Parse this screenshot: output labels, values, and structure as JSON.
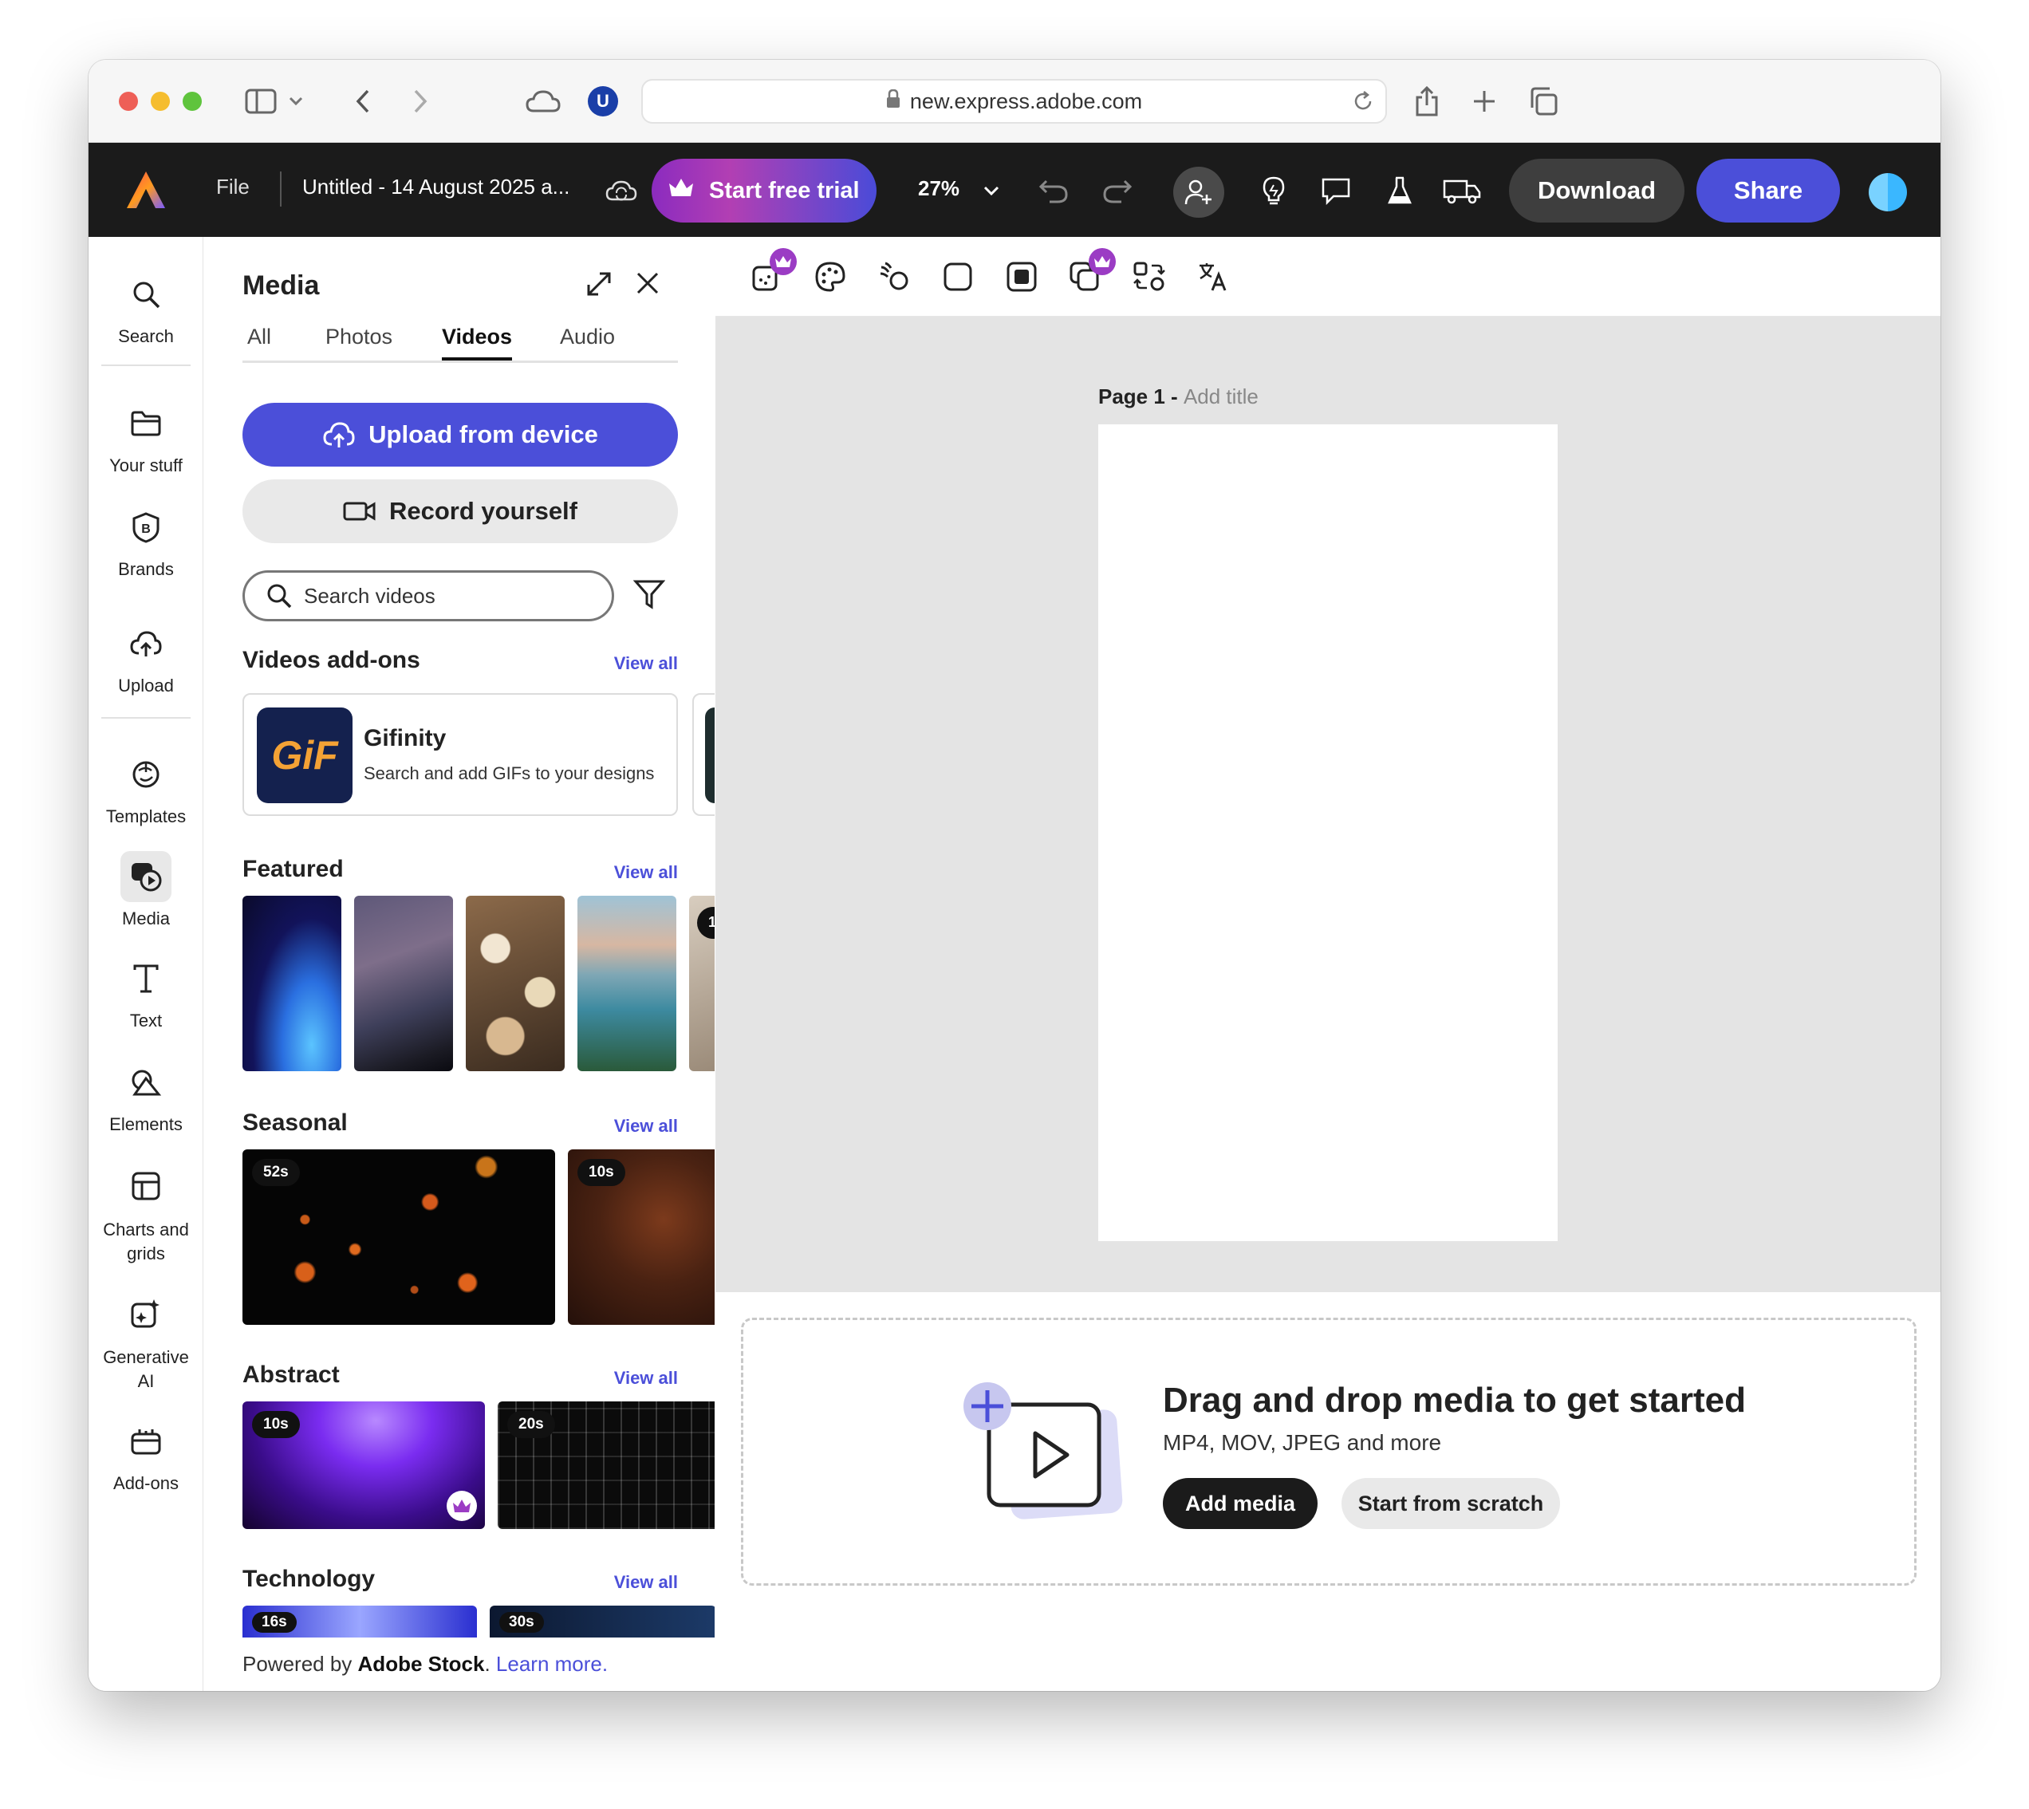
{
  "browser": {
    "url": "new.express.adobe.com",
    "extension_badge": "U"
  },
  "topbar": {
    "file_label": "File",
    "doc_title": "Untitled - 14 August 2025 a...",
    "trial_label": "Start free trial",
    "zoom": "27%",
    "download_label": "Download",
    "share_label": "Share"
  },
  "rail": {
    "items": [
      {
        "label": "Search",
        "icon": "search-icon"
      },
      {
        "label": "Your stuff",
        "icon": "folder-icon"
      },
      {
        "label": "Brands",
        "icon": "brand-icon"
      },
      {
        "label": "Upload",
        "icon": "upload-icon"
      },
      {
        "label": "Templates",
        "icon": "templates-icon"
      },
      {
        "label": "Media",
        "icon": "media-icon"
      },
      {
        "label": "Text",
        "icon": "text-icon"
      },
      {
        "label": "Elements",
        "icon": "elements-icon"
      },
      {
        "label": "Charts and grids",
        "icon": "charts-icon"
      },
      {
        "label": "Generative AI",
        "icon": "ai-icon"
      },
      {
        "label": "Add-ons",
        "icon": "addons-icon"
      }
    ],
    "active": "Media"
  },
  "panel": {
    "title": "Media",
    "tabs": [
      "All",
      "Photos",
      "Videos",
      "Audio"
    ],
    "active_tab": "Videos",
    "upload_label": "Upload from device",
    "record_label": "Record yourself",
    "search_placeholder": "Search videos",
    "view_all": "View all",
    "sections": {
      "addons": "Videos add-ons",
      "featured": "Featured",
      "seasonal": "Seasonal",
      "abstract": "Abstract",
      "technology": "Technology"
    },
    "addon": {
      "logo_text": "GiF",
      "name": "Gifinity",
      "description": "Search and add GIFs to your designs"
    },
    "seasonal_durations": [
      "52s",
      "10s"
    ],
    "abstract_durations": [
      "10s",
      "20s"
    ],
    "technology_durations": [
      "16s",
      "30s"
    ],
    "featured_partial_badge": "1",
    "footer": {
      "prefix": "Powered by ",
      "brand": "Adobe Stock",
      "sep": ". ",
      "link": "Learn more."
    }
  },
  "canvas": {
    "page_label": "Page 1 - ",
    "add_title": "Add title"
  },
  "dropzone": {
    "title": "Drag and drop media to get started",
    "subtitle": "MP4, MOV, JPEG and more",
    "add_media": "Add media",
    "start_scratch": "Start from scratch"
  },
  "colors": {
    "accent": "#4b4fd9",
    "topbar": "#1b1b1b",
    "premium": "#9b3cc4"
  }
}
